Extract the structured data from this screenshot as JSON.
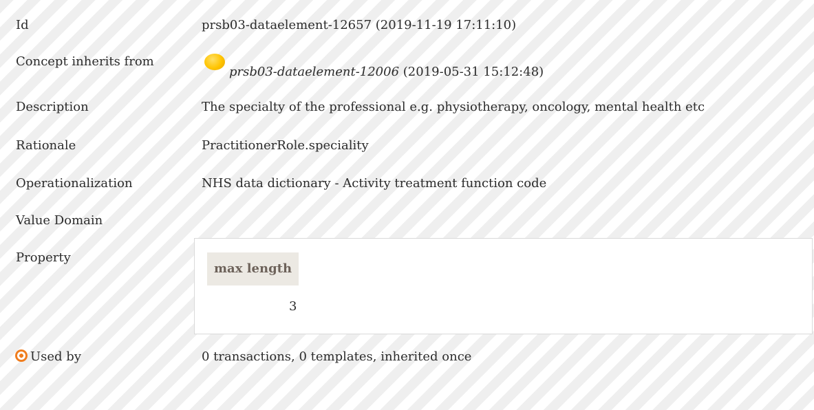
{
  "rows": {
    "id": {
      "label": "Id",
      "value": "prsb03-dataelement-12657 (2019-11-19 17:11:10)"
    },
    "inherits": {
      "label": "Concept inherits from",
      "link": "prsb03-dataelement-12006",
      "date": "(2019-05-31 15:12:48)"
    },
    "description": {
      "label": "Description",
      "value": "The specialty of the professional e.g. physiotherapy, oncology, mental health etc"
    },
    "rationale": {
      "label": "Rationale",
      "value": "PractitionerRole.speciality"
    },
    "operationalization": {
      "label": "Operationalization",
      "value": "NHS data dictionary - Activity treatment function code"
    },
    "value_domain": {
      "label": "Value Domain"
    },
    "property": {
      "label": "Property",
      "header": "max length",
      "value": "3"
    },
    "used_by": {
      "label": "Used by",
      "value": "0 transactions, 0 templates, inherited once"
    }
  },
  "colors": {
    "status_dot": "#ffc400",
    "used_by_icon": "#f07d1e",
    "header_bg": "#ece9e3",
    "header_text": "#6d625a"
  },
  "icons": {
    "status": "status-dot-icon",
    "used_by": "target-icon"
  }
}
